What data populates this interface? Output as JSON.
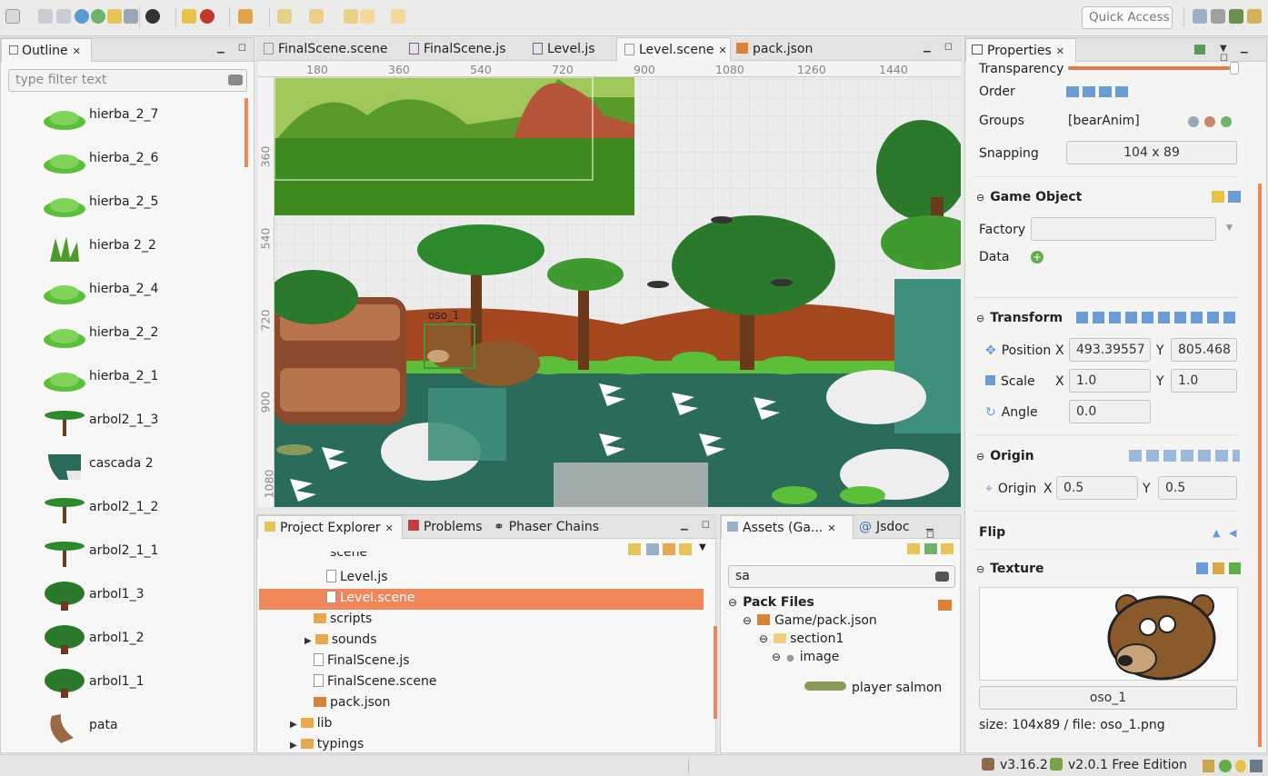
{
  "toolbar": {
    "quick_access": "Quick Access"
  },
  "outline": {
    "tab": "Outline",
    "filter_placeholder": "type filter text",
    "items": [
      {
        "label": "hierba_2_7",
        "icon": "grass"
      },
      {
        "label": "hierba_2_6",
        "icon": "grass"
      },
      {
        "label": "hierba_2_5",
        "icon": "grass"
      },
      {
        "label": "hierba 2_2",
        "icon": "tall-grass"
      },
      {
        "label": "hierba_2_4",
        "icon": "grass"
      },
      {
        "label": "hierba_2_2",
        "icon": "grass"
      },
      {
        "label": "hierba_2_1",
        "icon": "grass"
      },
      {
        "label": "arbol2_1_3",
        "icon": "palm"
      },
      {
        "label": "cascada 2",
        "icon": "waterfall"
      },
      {
        "label": "arbol2_1_2",
        "icon": "palm"
      },
      {
        "label": "arbol2_1_1",
        "icon": "palm"
      },
      {
        "label": "arbol1_3",
        "icon": "tree"
      },
      {
        "label": "arbol1_2",
        "icon": "tree"
      },
      {
        "label": "arbol1_1",
        "icon": "tree"
      },
      {
        "label": "pata",
        "icon": "leg"
      }
    ]
  },
  "editor": {
    "tabs": [
      "FinalScene.scene",
      "FinalScene.js",
      "Level.js",
      "Level.scene",
      "pack.json"
    ],
    "active_tab": "Level.scene",
    "ruler_x": [
      "180",
      "360",
      "540",
      "720",
      "900",
      "1080",
      "1260",
      "1440"
    ],
    "ruler_y": [
      "360",
      "540",
      "720",
      "900",
      "1080"
    ],
    "selected_object": "oso_1"
  },
  "project_explorer": {
    "tabs": [
      "Project Explorer",
      "Problems",
      "Phaser Chains"
    ],
    "partial_top": "scene",
    "items": [
      {
        "label": "Level.js",
        "type": "js"
      },
      {
        "label": "Level.scene",
        "type": "scene",
        "selected": true
      },
      {
        "label": "scripts",
        "type": "folder"
      },
      {
        "label": "sounds",
        "type": "folder",
        "expandable": true
      },
      {
        "label": "FinalScene.js",
        "type": "js"
      },
      {
        "label": "FinalScene.scene",
        "type": "scene"
      },
      {
        "label": "pack.json",
        "type": "json"
      },
      {
        "label": "lib",
        "type": "folder",
        "expandable": true
      },
      {
        "label": "typings",
        "type": "folder",
        "expandable": true
      }
    ]
  },
  "assets": {
    "tabs": [
      "Assets (Ga...",
      "Jsdoc"
    ],
    "search_value": "sa",
    "pack_files": "Pack Files",
    "pack": "Game/pack.json",
    "section": "section1",
    "type": "image",
    "asset": "player salmon"
  },
  "properties": {
    "tab": "Properties",
    "transparency_label": "Transparency",
    "transparency_value": 0.97,
    "order_label": "Order",
    "groups_label": "Groups",
    "groups_value": "[bearAnim]",
    "snapping_label": "Snapping",
    "snapping_value": "104 x 89",
    "game_object_title": "Game Object",
    "factory_label": "Factory",
    "factory_value": "",
    "data_label": "Data",
    "transform_title": "Transform",
    "position_label": "Position",
    "x_label": "X",
    "y_label": "Y",
    "position_x": "493.39557",
    "position_y": "805.468",
    "scale_label": "Scale",
    "scale_x": "1.0",
    "scale_y": "1.0",
    "angle_label": "Angle",
    "angle_value": "0.0",
    "origin_title": "Origin",
    "origin_label": "Origin",
    "origin_x": "0.5",
    "origin_y": "0.5",
    "flip_title": "Flip",
    "texture_title": "Texture",
    "texture_key": "oso_1",
    "texture_info": "size: 104x89 / file: oso_1.png"
  },
  "status": {
    "version": "v3.16.2",
    "edition": "v2.0.1 Free Edition"
  },
  "colors": {
    "accent": "#f0875a",
    "grass": "#5cbf3a",
    "water": "#2a6b5c",
    "bear": "#8b5a2b"
  }
}
